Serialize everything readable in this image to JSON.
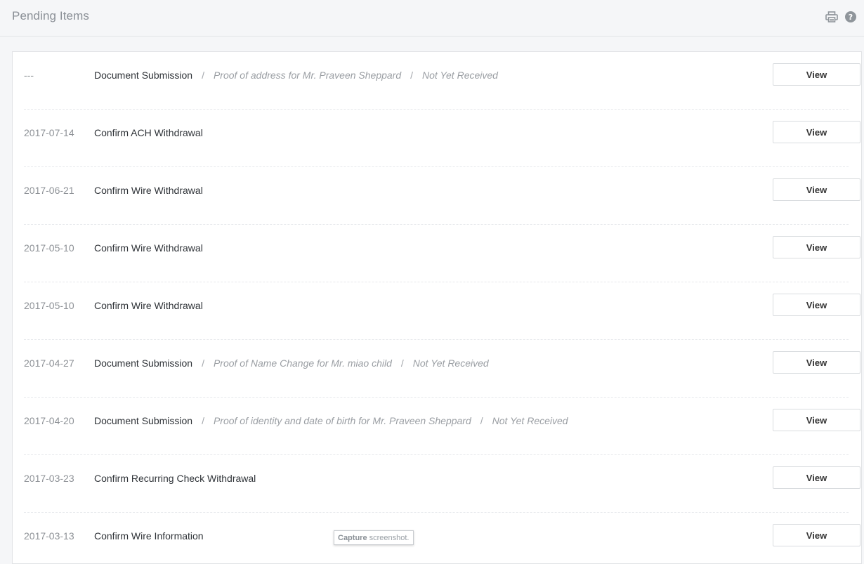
{
  "header": {
    "title": "Pending Items",
    "icons": [
      "print-icon",
      "help-icon"
    ]
  },
  "items": [
    {
      "date": "---",
      "title": "Document Submission",
      "detail": "Proof of address for Mr. Praveen Sheppard",
      "status": "Not Yet Received",
      "action": "View"
    },
    {
      "date": "2017-07-14",
      "title": "Confirm ACH Withdrawal",
      "detail": "",
      "status": "",
      "action": "View"
    },
    {
      "date": "2017-06-21",
      "title": "Confirm Wire Withdrawal",
      "detail": "",
      "status": "",
      "action": "View"
    },
    {
      "date": "2017-05-10",
      "title": "Confirm Wire Withdrawal",
      "detail": "",
      "status": "",
      "action": "View"
    },
    {
      "date": "2017-05-10",
      "title": "Confirm Wire Withdrawal",
      "detail": "",
      "status": "",
      "action": "View"
    },
    {
      "date": "2017-04-27",
      "title": "Document Submission",
      "detail": "Proof of Name Change for Mr. miao child",
      "status": "Not Yet Received",
      "action": "View"
    },
    {
      "date": "2017-04-20",
      "title": "Document Submission",
      "detail": "Proof of identity and date of birth for Mr. Praveen Sheppard",
      "status": "Not Yet Received",
      "action": "View"
    },
    {
      "date": "2017-03-23",
      "title": "Confirm Recurring Check Withdrawal",
      "detail": "",
      "status": "",
      "action": "View"
    },
    {
      "date": "2017-03-13",
      "title": "Confirm Wire Information",
      "detail": "",
      "status": "",
      "action": "View"
    }
  ],
  "separator": "/",
  "tooltip": {
    "bold": "Capture",
    "text": "screenshot."
  },
  "colors": {
    "page_bg": "#f5f6f8",
    "panel_bg": "#ffffff",
    "muted_text": "#8e9297",
    "title_text": "#2f3338"
  }
}
